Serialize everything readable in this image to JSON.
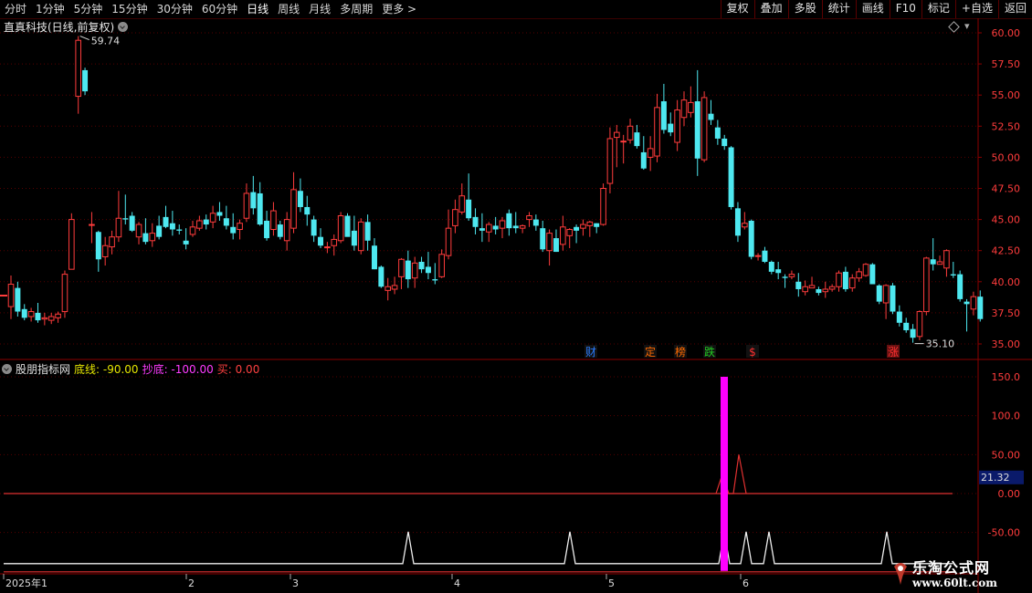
{
  "toolbar": {
    "periods": [
      "分时",
      "1分钟",
      "5分钟",
      "15分钟",
      "30分钟",
      "60分钟",
      "日线",
      "周线",
      "月线",
      "多周期",
      "更多 >"
    ],
    "active": "日线",
    "right_buttons": [
      "复权",
      "叠加",
      "多股",
      "统计",
      "画线",
      "F10",
      "标记",
      "+自选",
      "返回"
    ]
  },
  "stock": {
    "title": "直真科技(日线,前复权)"
  },
  "price_axis": {
    "ticks": [
      "60.00",
      "57.50",
      "55.00",
      "52.50",
      "50.00",
      "47.50",
      "45.00",
      "42.50",
      "40.00",
      "37.50",
      "35.00"
    ],
    "min": 35.0,
    "max": 60.0
  },
  "annotations": {
    "high": "59.74",
    "low": "35.10"
  },
  "event_markers": [
    {
      "label": "财",
      "color": "#2a7cff"
    },
    {
      "label": "定",
      "color": "#ff6a00"
    },
    {
      "label": "榜",
      "color": "#ff6a00"
    },
    {
      "label": "跌",
      "color": "#22cc22"
    },
    {
      "label": "$",
      "color": "#ff3030"
    },
    {
      "label": "涨",
      "color": "#ff3030"
    }
  ],
  "indicator": {
    "name": "股朋指标网",
    "line1": "底线: -90.00",
    "line2": "抄底: -100.00",
    "line3": "买: 0.00",
    "axis_ticks": [
      "150.0",
      "100.0",
      "50.00",
      "0.00",
      "-50.00"
    ],
    "current_value": "21.32"
  },
  "date_axis": {
    "labels": [
      "2025年1",
      "2",
      "3",
      "4",
      "5",
      "6"
    ]
  },
  "watermark": {
    "line1": "乐淘公式网",
    "line2": "www.60lt.com"
  },
  "colors": {
    "up": "#ff3c3c",
    "down": "#4ee8f0",
    "axis": "#8b0000",
    "magenta": "#ff00ff"
  },
  "chart_data": {
    "type": "candlestick",
    "ohlc": [
      [
        38.0,
        40.5,
        37.0,
        39.8
      ],
      [
        39.5,
        40.0,
        37.2,
        37.6
      ],
      [
        37.8,
        38.2,
        36.9,
        37.1
      ],
      [
        37.2,
        37.9,
        36.8,
        37.6
      ],
      [
        37.5,
        38.3,
        36.7,
        36.9
      ],
      [
        37.0,
        37.5,
        36.5,
        37.1
      ],
      [
        36.9,
        37.5,
        36.6,
        37.2
      ],
      [
        37.1,
        37.6,
        36.7,
        37.4
      ],
      [
        37.6,
        40.9,
        37.1,
        40.6
      ],
      [
        41.0,
        45.5,
        41.0,
        45.0
      ],
      [
        54.9,
        59.74,
        53.5,
        59.4
      ],
      [
        57.0,
        57.2,
        55.0,
        55.3
      ],
      [
        44.6,
        45.6,
        43.1,
        44.6
      ],
      [
        44.0,
        44.1,
        40.8,
        41.8
      ],
      [
        42.0,
        43.6,
        41.3,
        42.9
      ],
      [
        42.8,
        44.1,
        42.2,
        43.6
      ],
      [
        43.6,
        47.3,
        43.2,
        45.1
      ],
      [
        45.1,
        47.0,
        44.6,
        45.0
      ],
      [
        45.3,
        45.6,
        44.0,
        44.1
      ],
      [
        43.6,
        44.8,
        43.0,
        44.6
      ],
      [
        43.9,
        45.1,
        43.0,
        43.2
      ],
      [
        43.3,
        44.7,
        42.8,
        43.9
      ],
      [
        44.5,
        45.3,
        43.4,
        43.6
      ],
      [
        45.2,
        46.1,
        44.3,
        44.4
      ],
      [
        44.7,
        45.7,
        43.7,
        44.2
      ],
      [
        44.2,
        44.6,
        43.8,
        44.1
      ],
      [
        43.3,
        44.3,
        42.6,
        43.0
      ],
      [
        43.8,
        44.9,
        43.6,
        44.4
      ],
      [
        44.3,
        45.3,
        44.1,
        44.9
      ],
      [
        45.0,
        45.4,
        44.2,
        44.6
      ],
      [
        44.8,
        46.1,
        44.3,
        45.5
      ],
      [
        45.6,
        46.4,
        44.9,
        45.3
      ],
      [
        45.1,
        46.1,
        44.2,
        44.5
      ],
      [
        44.4,
        45.5,
        43.4,
        43.9
      ],
      [
        44.2,
        45.0,
        43.4,
        44.7
      ],
      [
        45.1,
        47.9,
        44.8,
        47.1
      ],
      [
        47.2,
        48.5,
        45.4,
        45.9
      ],
      [
        47.1,
        48.0,
        44.5,
        44.6
      ],
      [
        44.9,
        45.7,
        43.3,
        43.5
      ],
      [
        44.2,
        46.4,
        43.7,
        45.7
      ],
      [
        44.6,
        44.9,
        43.4,
        43.6
      ],
      [
        43.3,
        45.6,
        42.5,
        45.0
      ],
      [
        44.3,
        48.8,
        43.9,
        47.4
      ],
      [
        47.3,
        48.3,
        45.6,
        46.0
      ],
      [
        46.0,
        46.9,
        44.5,
        45.4
      ],
      [
        45.0,
        45.3,
        43.2,
        43.7
      ],
      [
        43.6,
        44.3,
        42.7,
        42.9
      ],
      [
        42.8,
        43.2,
        42.3,
        42.8
      ],
      [
        42.9,
        43.8,
        42.1,
        43.4
      ],
      [
        43.3,
        45.6,
        43.1,
        45.3
      ],
      [
        45.3,
        45.5,
        43.8,
        43.6
      ],
      [
        44.1,
        45.3,
        42.5,
        42.9
      ],
      [
        42.5,
        45.1,
        42.2,
        44.8
      ],
      [
        44.8,
        45.4,
        42.5,
        43.3
      ],
      [
        42.9,
        43.5,
        41.0,
        41.0
      ],
      [
        41.2,
        41.3,
        39.5,
        39.6
      ],
      [
        39.3,
        40.3,
        38.5,
        39.6
      ],
      [
        39.4,
        40.4,
        39.0,
        39.7
      ],
      [
        40.4,
        41.9,
        39.4,
        41.8
      ],
      [
        41.7,
        42.5,
        39.5,
        40.2
      ],
      [
        40.3,
        42.0,
        39.5,
        41.5
      ],
      [
        41.6,
        42.0,
        40.7,
        41.0
      ],
      [
        41.2,
        42.4,
        40.2,
        40.7
      ],
      [
        40.2,
        41.5,
        39.8,
        40.1
      ],
      [
        40.4,
        42.6,
        40.3,
        42.2
      ],
      [
        42.1,
        45.8,
        41.8,
        44.3
      ],
      [
        44.5,
        46.6,
        43.9,
        45.8
      ],
      [
        45.6,
        47.9,
        45.4,
        46.9
      ],
      [
        46.6,
        48.7,
        44.9,
        45.1
      ],
      [
        45.2,
        45.9,
        43.8,
        44.4
      ],
      [
        44.3,
        45.5,
        43.2,
        44.1
      ],
      [
        44.0,
        44.8,
        43.2,
        44.6
      ],
      [
        44.5,
        45.2,
        43.8,
        44.2
      ],
      [
        44.3,
        45.2,
        43.5,
        44.9
      ],
      [
        45.5,
        45.8,
        43.7,
        44.3
      ],
      [
        44.5,
        45.6,
        43.9,
        44.3
      ],
      [
        44.3,
        44.6,
        43.9,
        44.5
      ],
      [
        45.0,
        45.6,
        44.4,
        45.3
      ],
      [
        45.0,
        45.4,
        44.1,
        44.5
      ],
      [
        44.3,
        44.9,
        42.4,
        42.6
      ],
      [
        42.5,
        44.2,
        41.3,
        43.9
      ],
      [
        43.5,
        44.2,
        42.4,
        42.4
      ],
      [
        43.0,
        45.3,
        42.5,
        44.4
      ],
      [
        43.7,
        44.3,
        42.7,
        44.2
      ],
      [
        44.4,
        44.6,
        43.1,
        44.1
      ],
      [
        44.3,
        45.0,
        43.7,
        44.6
      ],
      [
        44.5,
        44.9,
        43.6,
        44.8
      ],
      [
        44.7,
        44.7,
        43.9,
        44.4
      ],
      [
        44.6,
        47.9,
        44.5,
        47.5
      ],
      [
        47.9,
        52.4,
        47.1,
        51.5
      ],
      [
        51.6,
        52.6,
        49.2,
        52.0
      ],
      [
        51.3,
        51.8,
        49.5,
        51.3
      ],
      [
        51.4,
        53.1,
        51.1,
        52.5
      ],
      [
        52.0,
        52.6,
        50.7,
        50.9
      ],
      [
        50.4,
        51.7,
        49.0,
        49.1
      ],
      [
        50.0,
        51.7,
        48.9,
        50.7
      ],
      [
        50.1,
        55.1,
        49.6,
        54.0
      ],
      [
        54.5,
        55.9,
        51.9,
        52.2
      ],
      [
        52.7,
        53.6,
        51.7,
        52.0
      ],
      [
        51.2,
        54.6,
        50.5,
        53.8
      ],
      [
        53.2,
        55.3,
        52.5,
        54.6
      ],
      [
        53.6,
        55.7,
        53.2,
        54.4
      ],
      [
        54.5,
        57.0,
        48.5,
        49.9
      ],
      [
        49.8,
        55.3,
        49.6,
        54.8
      ],
      [
        53.5,
        54.6,
        52.6,
        53.0
      ],
      [
        52.4,
        53.0,
        51.0,
        51.5
      ],
      [
        51.5,
        51.8,
        50.6,
        50.9
      ],
      [
        50.8,
        50.9,
        45.8,
        46.0
      ],
      [
        45.9,
        46.4,
        43.2,
        43.7
      ],
      [
        44.4,
        45.6,
        44.2,
        44.7
      ],
      [
        44.9,
        45.0,
        41.8,
        42.0
      ],
      [
        42.1,
        42.3,
        41.7,
        42.1
      ],
      [
        42.5,
        42.8,
        41.5,
        41.6
      ],
      [
        41.6,
        41.7,
        40.6,
        40.8
      ],
      [
        41.0,
        41.6,
        40.2,
        40.7
      ],
      [
        40.4,
        40.6,
        39.5,
        40.3
      ],
      [
        40.4,
        40.9,
        40.2,
        40.6
      ],
      [
        40.0,
        40.7,
        38.8,
        39.4
      ],
      [
        39.2,
        40.1,
        38.9,
        39.6
      ],
      [
        39.5,
        40.4,
        39.5,
        39.7
      ],
      [
        39.4,
        39.6,
        38.9,
        39.1
      ],
      [
        39.2,
        40.0,
        38.7,
        39.4
      ],
      [
        39.4,
        39.8,
        39.2,
        39.6
      ],
      [
        39.6,
        40.9,
        39.2,
        40.7
      ],
      [
        40.8,
        41.2,
        39.2,
        39.4
      ],
      [
        39.5,
        40.6,
        39.2,
        40.3
      ],
      [
        40.3,
        41.1,
        40.0,
        40.8
      ],
      [
        40.5,
        41.5,
        40.4,
        41.4
      ],
      [
        41.4,
        41.5,
        39.9,
        39.8
      ],
      [
        39.7,
        39.8,
        38.2,
        38.4
      ],
      [
        38.3,
        39.8,
        37.0,
        39.7
      ],
      [
        39.7,
        39.9,
        37.4,
        37.6
      ],
      [
        37.6,
        38.1,
        36.4,
        36.7
      ],
      [
        36.7,
        37.1,
        35.9,
        36.1
      ],
      [
        36.2,
        36.6,
        35.1,
        35.5
      ],
      [
        35.6,
        37.7,
        35.3,
        37.6
      ],
      [
        37.6,
        42.0,
        37.3,
        41.9
      ],
      [
        41.8,
        43.5,
        40.9,
        41.4
      ],
      [
        41.4,
        42.1,
        41.4,
        41.6
      ],
      [
        41.1,
        42.6,
        40.4,
        42.5
      ],
      [
        40.6,
        41.6,
        40.3,
        40.5
      ],
      [
        40.6,
        40.9,
        38.4,
        38.6
      ],
      [
        38.4,
        38.6,
        36.0,
        38.2
      ],
      [
        37.8,
        39.2,
        37.3,
        38.8
      ],
      [
        38.8,
        39.3,
        36.8,
        37.0
      ]
    ],
    "bottom_line_values": [
      -90.0
    ],
    "buy_signal_value": 150.0,
    "current_value": 21.32
  }
}
